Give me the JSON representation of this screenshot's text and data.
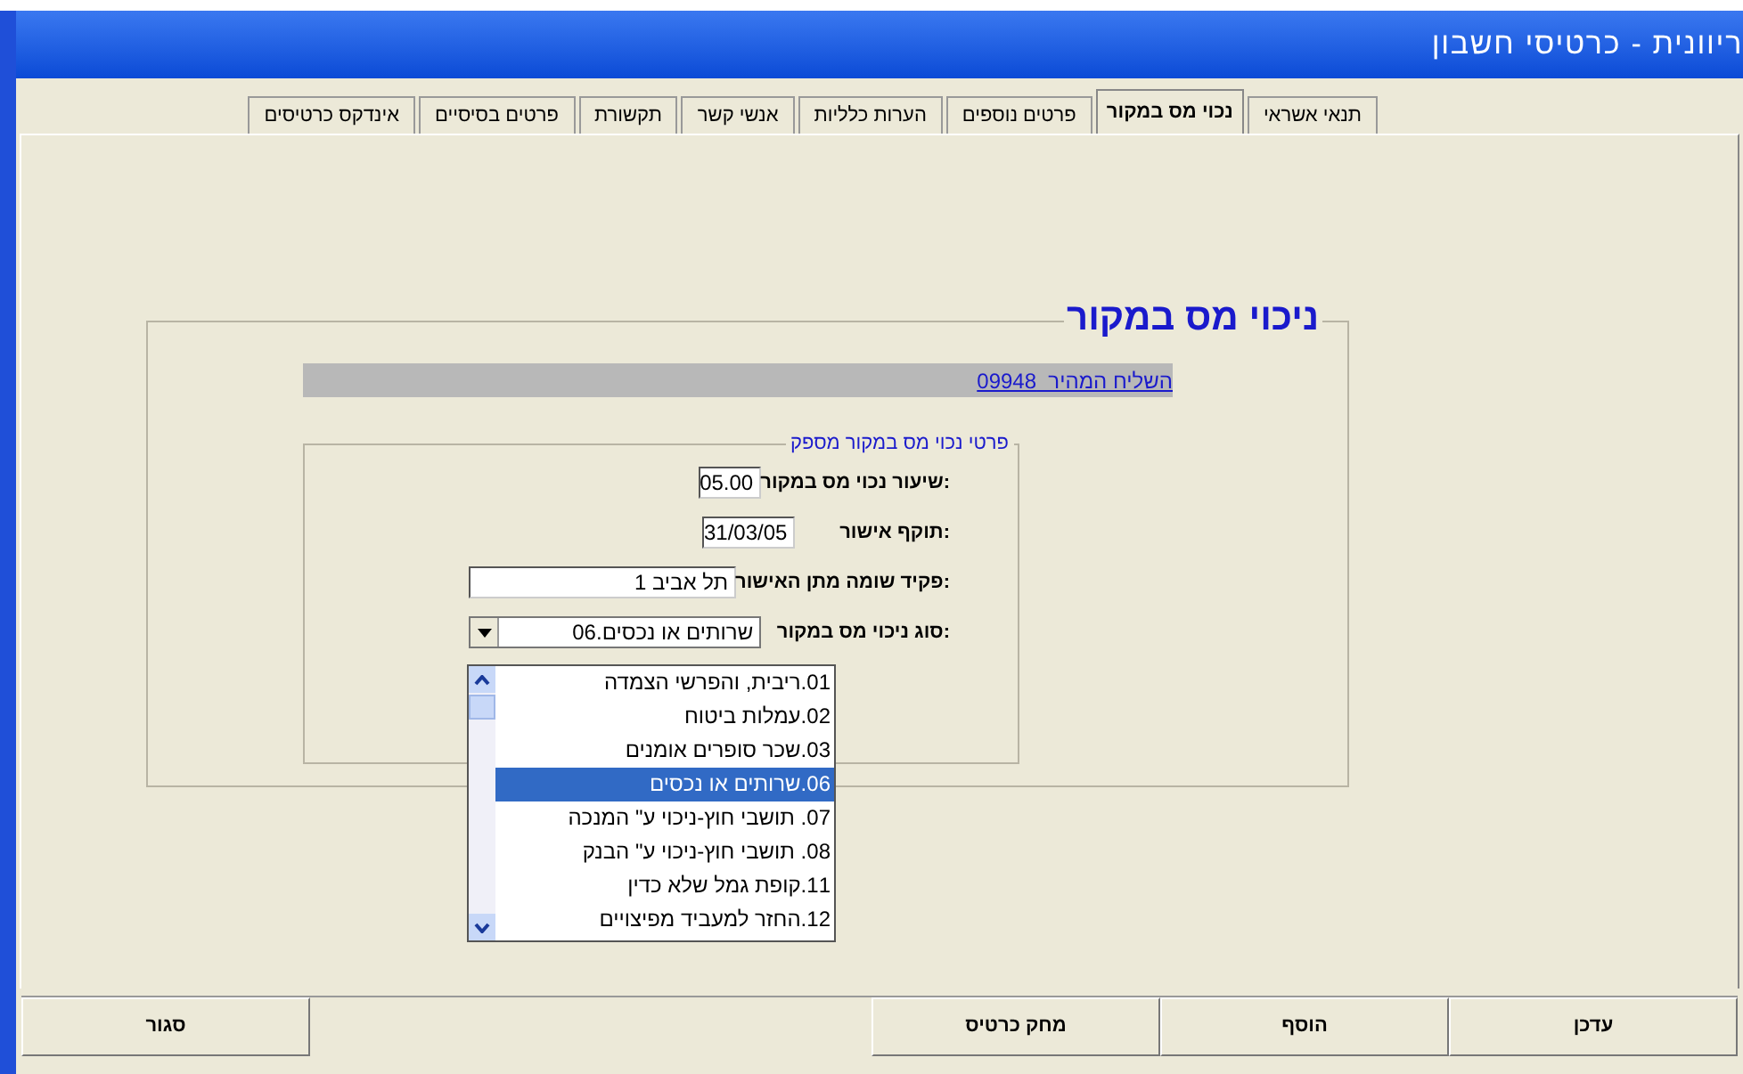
{
  "window": {
    "title": "ריוונית - כרטיסי חשבון"
  },
  "tabs": [
    {
      "label": "תנאי אשראי",
      "selected": false
    },
    {
      "label": "נכוי מס במקור",
      "selected": true
    },
    {
      "label": "פרטים נוספים",
      "selected": false
    },
    {
      "label": "הערות כלליות",
      "selected": false
    },
    {
      "label": "אנשי קשר",
      "selected": false
    },
    {
      "label": "תקשורת",
      "selected": false
    },
    {
      "label": "פרטים בסיסיים",
      "selected": false
    },
    {
      "label": "אינדקס כרטיסים",
      "selected": false
    }
  ],
  "section": {
    "title": "ניכוי מס במקור",
    "account_link": "השליח המהיר  09948",
    "group": {
      "title": "פרטי נכוי מס במקור מספק",
      "fields": [
        {
          "kind": "text",
          "label": "שיעור נכוי מס במקור:",
          "value": "05.00"
        },
        {
          "kind": "text",
          "label": "תוקף אישור:",
          "value": "31/03/05"
        },
        {
          "kind": "wide",
          "label": "פקיד שומה מתן האישור:",
          "value": "תל אביב 1"
        },
        {
          "kind": "combo",
          "label": "סוג ניכוי מס במקור:",
          "value": "06.שרותים או נכסים"
        }
      ]
    }
  },
  "dropdown": {
    "options": [
      {
        "label": "01.ריבית, והפרשי הצמדה",
        "selected": false
      },
      {
        "label": "02.עמלות ביטוח",
        "selected": false
      },
      {
        "label": "03.שכר סופרים אומנים",
        "selected": false
      },
      {
        "label": "06.שרותים או נכסים",
        "selected": true
      },
      {
        "label": "07. תושבי חוץ-ניכוי ע\" המנכה",
        "selected": false
      },
      {
        "label": "08. תושבי חוץ-ניכוי ע\" הבנק",
        "selected": false
      },
      {
        "label": "11.קופת גמל שלא כדין",
        "selected": false
      },
      {
        "label": "12.החזר למעביד מפיצויים",
        "selected": false
      }
    ]
  },
  "buttons": [
    {
      "kind": "wide",
      "label": "עדכן"
    },
    {
      "kind": "wide",
      "label": "הוסף"
    },
    {
      "kind": "wide",
      "label": "מחק כרטיס"
    },
    {
      "kind": "gap"
    },
    {
      "kind": "wide",
      "label": "סגור"
    }
  ]
}
